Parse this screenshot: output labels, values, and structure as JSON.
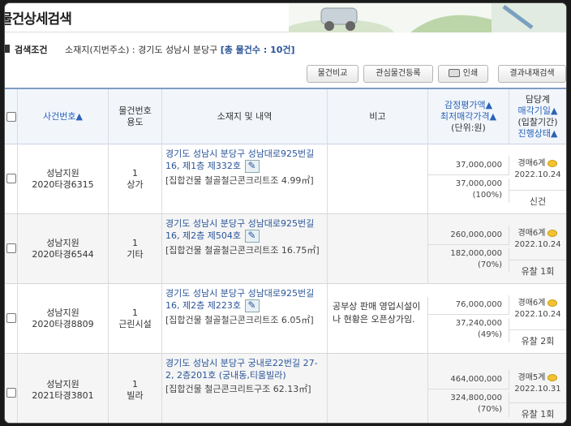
{
  "page": {
    "title": "물건상세검색"
  },
  "search_condition": {
    "label": "검색조건",
    "text": "소재지(지번주소) : 경기도 성남시 분당구",
    "count": "[총 물건수 : 10건]"
  },
  "toolbar": {
    "compare": "물건비교",
    "register": "관심물건등록",
    "print": "인쇄",
    "result_search": "결과내재검색"
  },
  "headers": {
    "case_no": "사건번호▲",
    "item_no": "물건번호",
    "use": "용도",
    "location": "소재지 및 내역",
    "note": "비고",
    "appraisal": "감정평가액▲",
    "min_price": "최저매각가격▲",
    "unit": "(단위:원)",
    "dept": "담당계",
    "sale_date": "매각기일▲",
    "bid_period": "(입찰기간)",
    "progress": "진행상태▲"
  },
  "rows": [
    {
      "court": "성남지원",
      "case": "2020타경6315",
      "item": "1",
      "use": "상가",
      "addr": "경기도 성남시 분당구 성남대로925번길 16, 제1층 제332호",
      "detail": "[집합건물 철골철근콘크리트조 4.99㎡]",
      "note": "",
      "appraisal": "37,000,000",
      "min": "37,000,000",
      "pct": "(100%)",
      "dept": "경매6계",
      "date": "2022.10.24",
      "status": "신건"
    },
    {
      "court": "성남지원",
      "case": "2020타경6544",
      "item": "1",
      "use": "기타",
      "addr": "경기도 성남시 분당구 성남대로925번길 16, 제2층 제504호",
      "detail": "[집합건물 철골철근콘크리트조 16.75㎡]",
      "note": "",
      "appraisal": "260,000,000",
      "min": "182,000,000",
      "pct": "(70%)",
      "dept": "경매6계",
      "date": "2022.10.24",
      "status": "유찰 1회"
    },
    {
      "court": "성남지원",
      "case": "2020타경8809",
      "item": "1",
      "use": "근린시설",
      "addr": "경기도 성남시 분당구 성남대로925번길 16, 제2층 제223호",
      "detail": "[집합건물 철골철근콘크리트조 6.05㎡]",
      "note": "공부상 판매 영업시설이나 현황은 오픈상가임.",
      "appraisal": "76,000,000",
      "min": "37,240,000",
      "pct": "(49%)",
      "dept": "경매6계",
      "date": "2022.10.24",
      "status": "유찰 2회"
    },
    {
      "court": "성남지원",
      "case": "2021타경3801",
      "item": "1",
      "use": "빌라",
      "addr": "경기도 성남시 분당구 궁내로22번길 27-2, 2층201호 (궁내동,티움빌라)",
      "detail": "[집합건물 철근콘크리트구조 62.13㎡]",
      "note": "",
      "appraisal": "464,000,000",
      "min": "324,800,000",
      "pct": "(70%)",
      "dept": "경매5계",
      "date": "2022.10.31",
      "status": "유찰 1회"
    }
  ]
}
